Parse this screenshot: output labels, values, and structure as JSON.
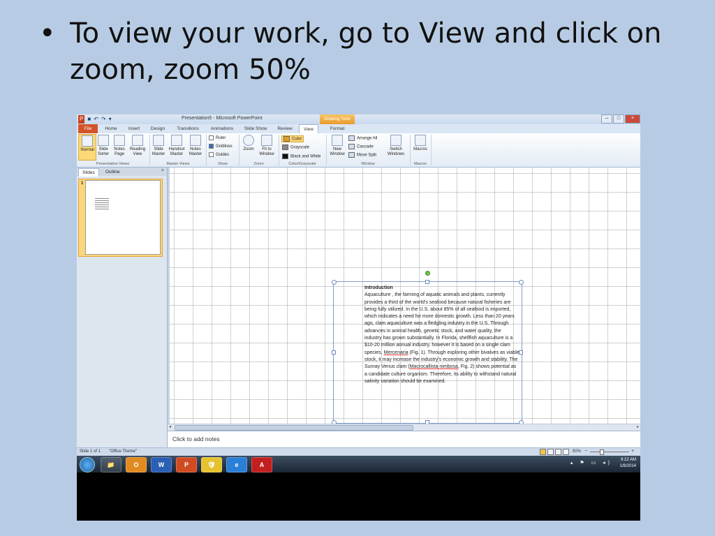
{
  "slide": {
    "bullet": "•",
    "text": "To view your work, go to View and click on zoom, zoom 50%"
  },
  "window": {
    "title": "Presentation5 - Microsoft PowerPoint",
    "drawing_tools": "Drawing Tools",
    "qat": [
      "P",
      "■",
      "↶",
      "↷",
      "▾"
    ]
  },
  "tabs": [
    "File",
    "Home",
    "Insert",
    "Design",
    "Transitions",
    "Animations",
    "Slide Show",
    "Review",
    "View",
    "Format"
  ],
  "active_tab": "View",
  "ribbon": {
    "presentation_views": {
      "label": "Presentation Views",
      "buttons": [
        "Normal",
        "Slide Sorter",
        "Notes Page",
        "Reading View"
      ]
    },
    "master_views": {
      "label": "Master Views",
      "buttons": [
        "Slide Master",
        "Handout Master",
        "Notes Master"
      ]
    },
    "show": {
      "label": "Show",
      "checks": [
        {
          "label": "Ruler",
          "checked": false
        },
        {
          "label": "Gridlines",
          "checked": true
        },
        {
          "label": "Guides",
          "checked": false
        }
      ]
    },
    "zoom": {
      "label": "Zoom",
      "buttons": [
        "Zoom",
        "Fit to Window"
      ]
    },
    "color_grayscale": {
      "label": "Color/Grayscale",
      "options": [
        "Color",
        "Grayscale",
        "Black and White"
      ],
      "colors": [
        "#e8a020",
        "#888888",
        "#111111"
      ]
    },
    "window": {
      "label": "Window",
      "new_window": "New Window",
      "options": [
        "Arrange All",
        "Cascade",
        "Move Split"
      ],
      "switch": "Switch Windows"
    },
    "macros": {
      "label": "Macros",
      "button": "Macros"
    }
  },
  "panel": {
    "tabs": [
      "Slides",
      "Outline"
    ],
    "close": "×",
    "slide_number": "1"
  },
  "textbox": {
    "title": "Introduction",
    "body_1": "Aquaculture , the farming of aquatic animals and plants, currently provides a third of the world's seafood because natural fisheries are being fully utilized. In the U.S. about 85% of all seafood is imported, which indicates a need for more domestic growth.  Less than 20 years ago, clam aquaculture was a fledgling industry in the U.S.  Through advances in animal health, genetic stock, and water quality, the industry has grown substantially. In Florida, shellfish aquaculture  is a $10-20 million annual industry, however it is based on a single clam species, ",
    "species_1": "Mercenaria",
    "body_2": " (Fig. 1). Through exploring other bivalves as viable stock, it may increase the industry's economic growth and stability. The Sunray Venus clam (",
    "species_2": "Macrocallista nimbosa",
    "body_3": ", Fig. 2) shows potential as a candidate culture organism.  Therefore, its ability to withstand natural salinity variation should be examined."
  },
  "notes": "Click to add notes",
  "status": {
    "slide": "Slide 1 of 1",
    "theme": "\"Office Theme\"",
    "zoom": "50%",
    "minus": "−",
    "plus": "+"
  },
  "taskbar": {
    "time": "9:22 AM",
    "date": "1/8/2014",
    "apps": [
      "📁",
      "O",
      "W",
      "P",
      "🛡",
      "e",
      "A"
    ]
  }
}
